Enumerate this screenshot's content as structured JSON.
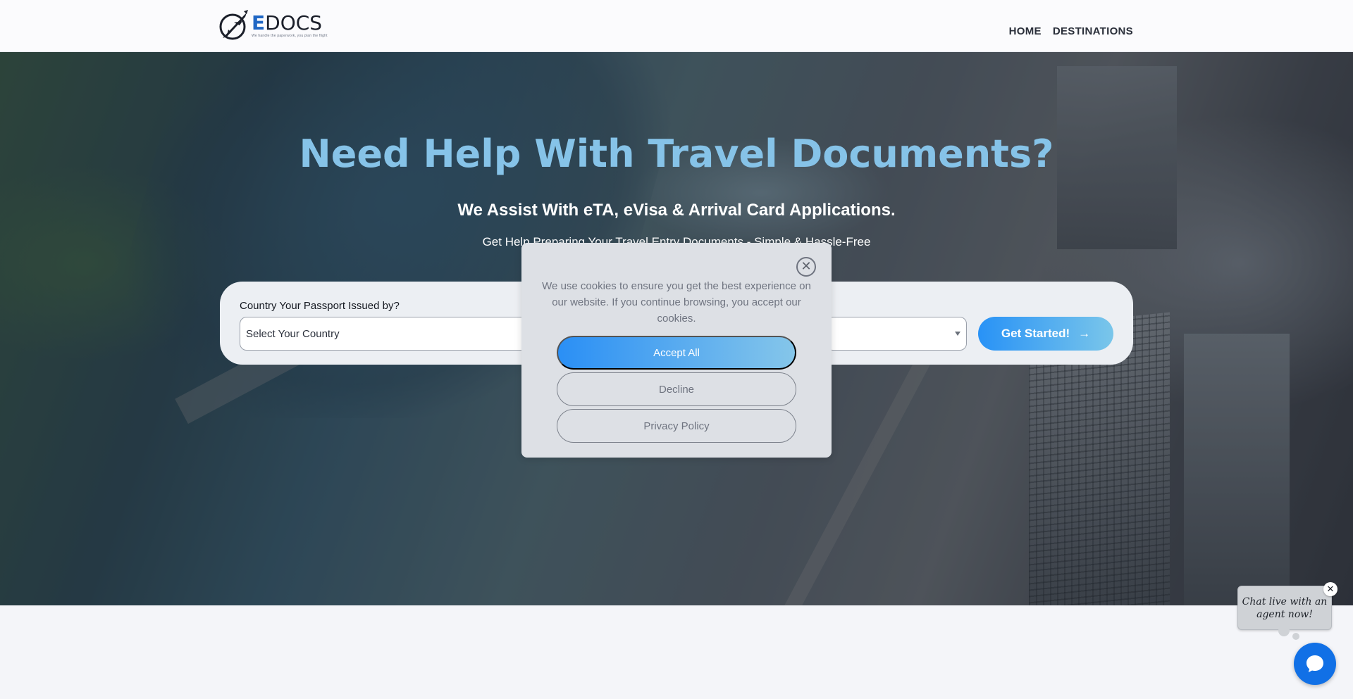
{
  "header": {
    "logo_first_letter": "E",
    "logo_rest": "DOCS",
    "logo_tagline": "We handle the paperwork, you plan the flight",
    "nav": [
      {
        "label": "HOME"
      },
      {
        "label": "DESTINATIONS"
      }
    ]
  },
  "hero": {
    "title": "Need Help With Travel Documents?",
    "subtitle": "We Assist With eTA, eVisa & Arrival Card Applications.",
    "tagline": "Get Help Preparing Your Travel Entry Documents - Simple & Hassle-Free"
  },
  "form": {
    "passport_label": "Country Your Passport Issued by?",
    "country_select_value": "Select Your Country",
    "destination_select_value": "",
    "submit_label": "Get Started!",
    "submit_arrow": "→"
  },
  "cookie_modal": {
    "close_glyph": "✕",
    "message": "We use cookies to ensure you get the best experience on our website. If you continue browsing, you accept our cookies.",
    "accept_label": "Accept All",
    "decline_label": "Decline",
    "privacy_label": "Privacy Policy"
  },
  "chat": {
    "bubble_text": "Chat live with an agent now!",
    "close_glyph": "✕"
  },
  "colors": {
    "accent_blue": "#2892f6",
    "title_blue": "#86c3e8",
    "chat_blue": "#1170e6"
  }
}
